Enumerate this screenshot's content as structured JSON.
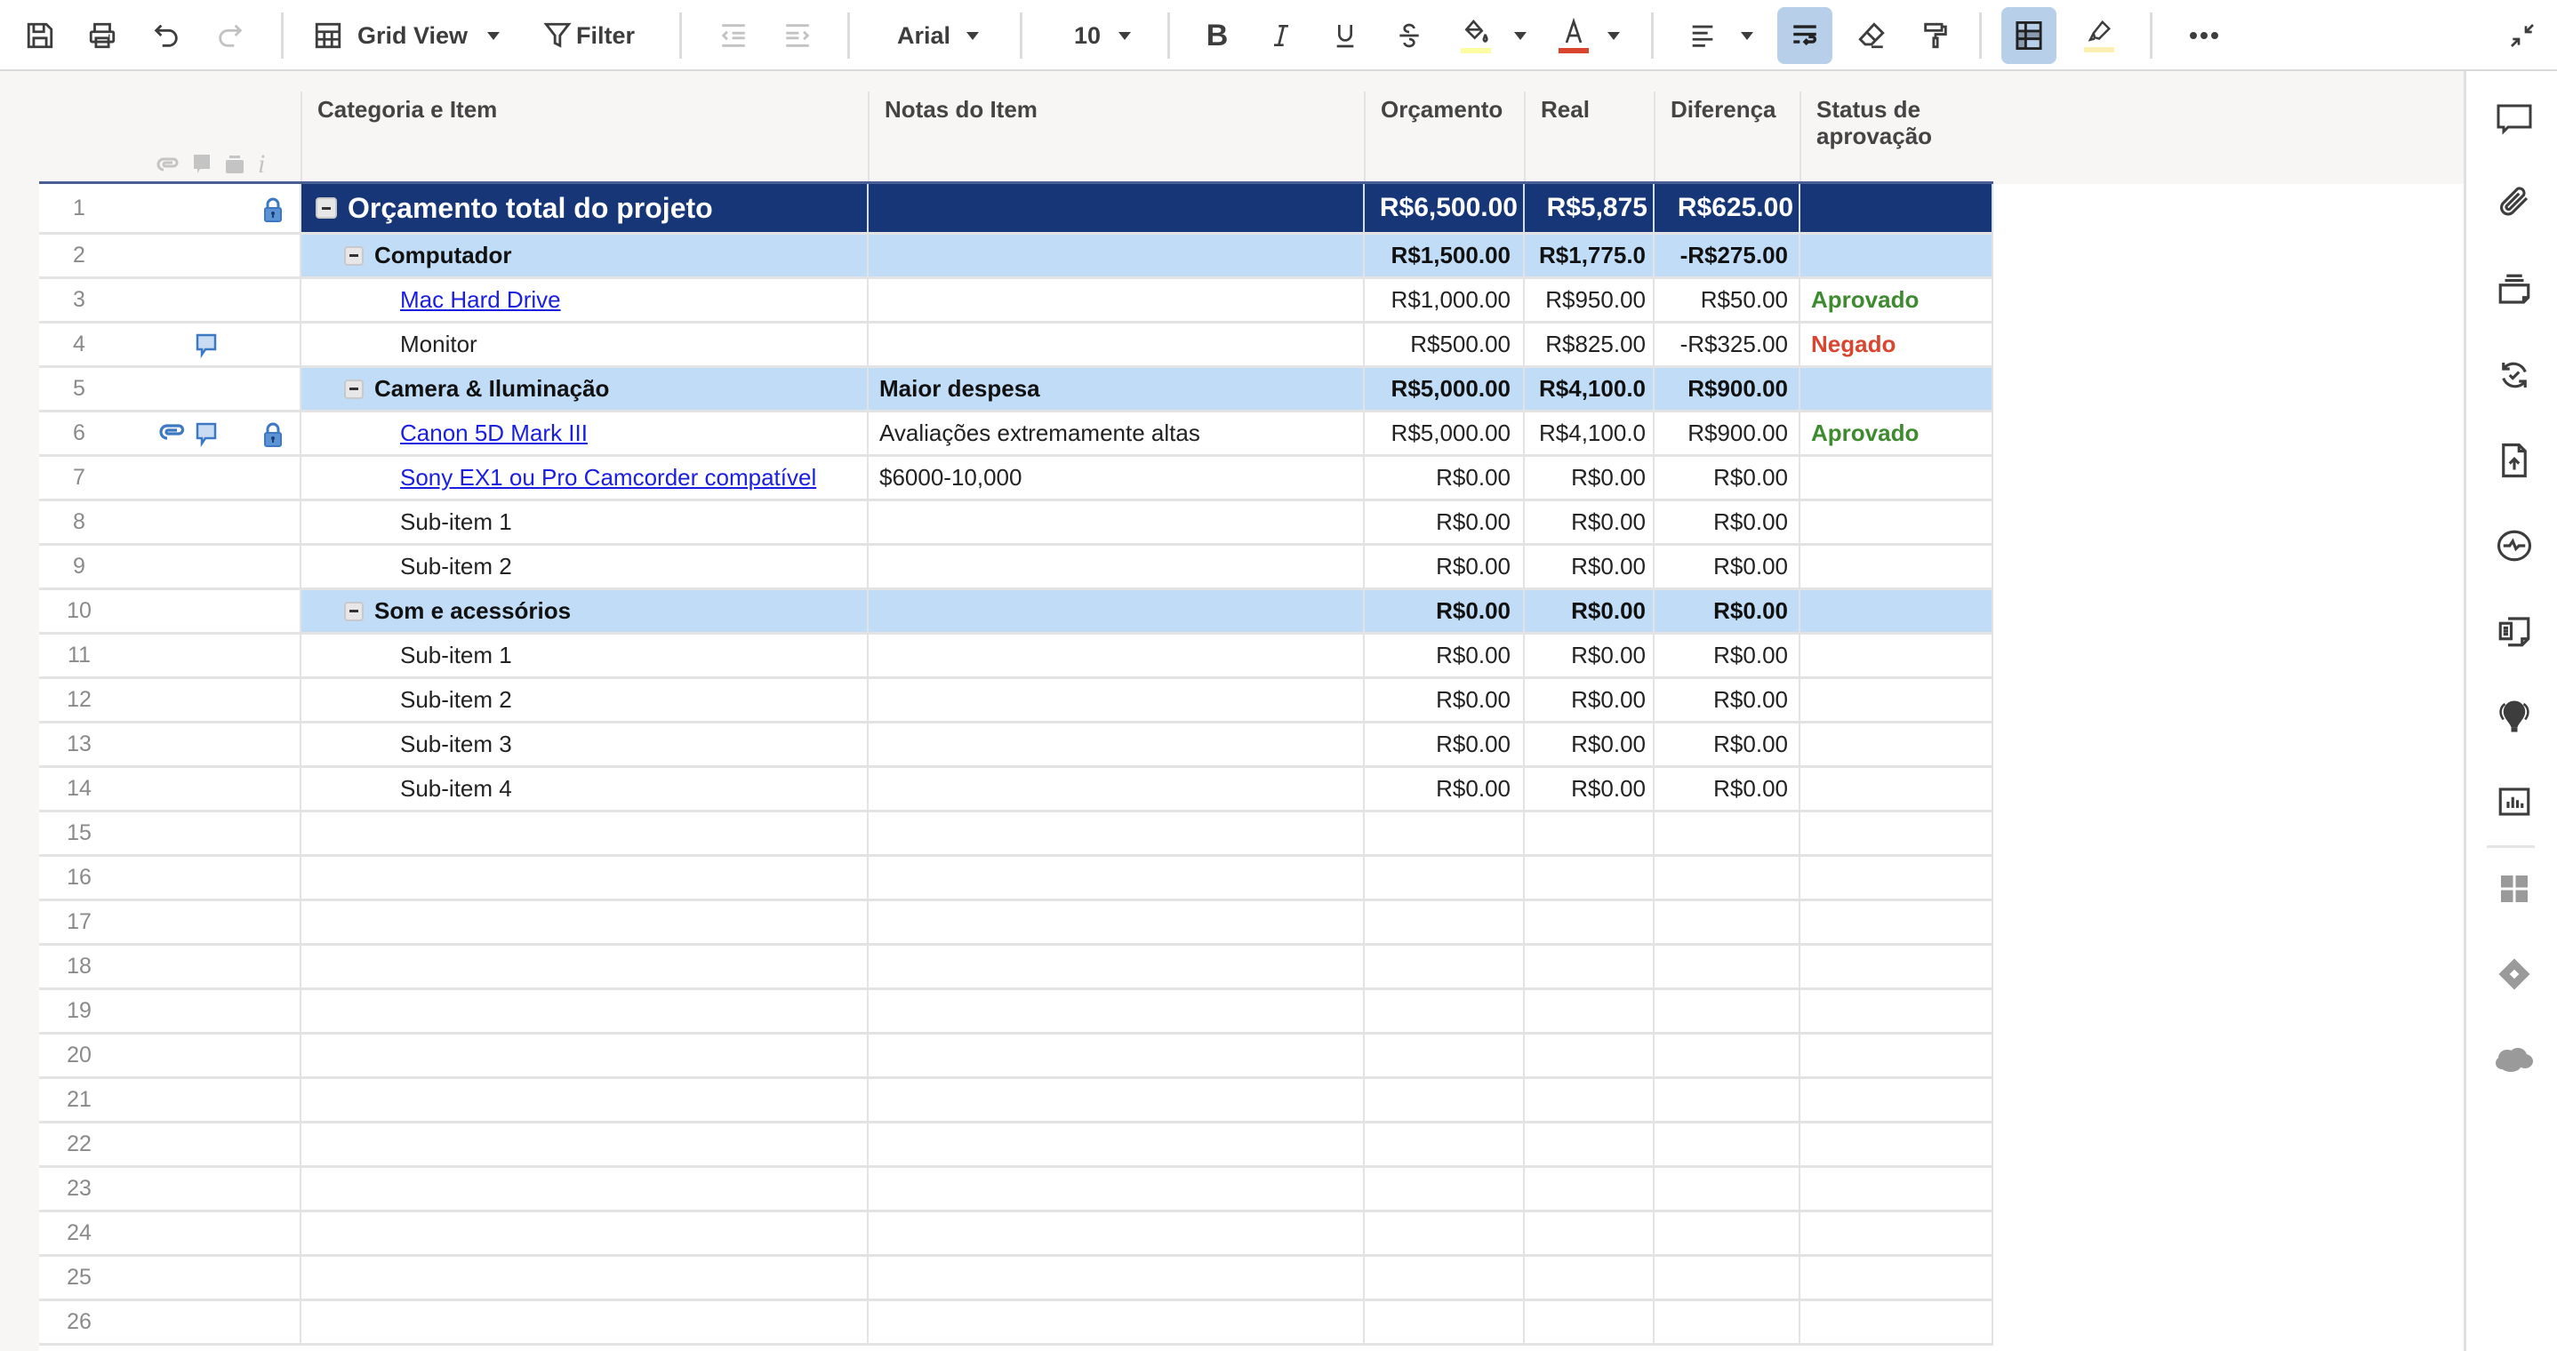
{
  "toolbar": {
    "view_label": "Grid View",
    "filter_label": "Filter",
    "font_name": "Arial",
    "font_size": "10",
    "fill_color": "#fdfca0",
    "text_color": "#d9452f",
    "highlight_color": "#fdf0b0",
    "wrap_text_active": true,
    "gridlines_active": true
  },
  "columns": {
    "category": "Categoria e Item",
    "notes": "Notas do Item",
    "budget": "Orçamento",
    "actual": "Real",
    "difference": "Diferença",
    "status": "Status de aprovação"
  },
  "colors": {
    "top_row_bg": "#163677",
    "group_row_bg": "#c0dcf6",
    "approved": "#3d8a2f",
    "denied": "#d9452f",
    "link": "#1a1ee0"
  },
  "rows": [
    {
      "n": "1",
      "level": 0,
      "category": "Orçamento total do projeto",
      "notes": "",
      "budget": "R$6,500.00",
      "actual": "R$5,875",
      "difference": "R$625.00",
      "status": "",
      "icons": [
        "lock"
      ]
    },
    {
      "n": "2",
      "level": 1,
      "category": "Computador",
      "notes": "",
      "budget": "R$1,500.00",
      "actual": "R$1,775.0",
      "difference": "-R$275.00",
      "status": "",
      "icons": []
    },
    {
      "n": "3",
      "level": 2,
      "category": "Mac Hard Drive",
      "link": true,
      "notes": "",
      "budget": "R$1,000.00",
      "actual": "R$950.00",
      "difference": "R$50.00",
      "status": "Aprovado",
      "icons": []
    },
    {
      "n": "4",
      "level": 2,
      "category": "Monitor",
      "notes": "",
      "budget": "R$500.00",
      "actual": "R$825.00",
      "difference": "-R$325.00",
      "status": "Negado",
      "icons": [
        "comment"
      ]
    },
    {
      "n": "5",
      "level": 1,
      "category": "Camera & Iluminação",
      "notes": "Maior despesa",
      "budget": "R$5,000.00",
      "actual": "R$4,100.0",
      "difference": "R$900.00",
      "status": "",
      "icons": []
    },
    {
      "n": "6",
      "level": 2,
      "category": "Canon 5D Mark III",
      "link": true,
      "notes": "Avaliações extremamente altas",
      "budget": "R$5,000.00",
      "actual": "R$4,100.0",
      "difference": "R$900.00",
      "status": "Aprovado",
      "icons": [
        "attachment",
        "comment",
        "lock"
      ]
    },
    {
      "n": "7",
      "level": 2,
      "category": "Sony EX1 ou Pro Camcorder compatível",
      "link": true,
      "notes": "$6000-10,000",
      "budget": "R$0.00",
      "actual": "R$0.00",
      "difference": "R$0.00",
      "status": "",
      "icons": []
    },
    {
      "n": "8",
      "level": 2,
      "category": "Sub-item 1",
      "notes": "",
      "budget": "R$0.00",
      "actual": "R$0.00",
      "difference": "R$0.00",
      "status": "",
      "icons": []
    },
    {
      "n": "9",
      "level": 2,
      "category": "Sub-item 2",
      "notes": "",
      "budget": "R$0.00",
      "actual": "R$0.00",
      "difference": "R$0.00",
      "status": "",
      "icons": []
    },
    {
      "n": "10",
      "level": 1,
      "category": "Som e acessórios",
      "notes": "",
      "budget": "R$0.00",
      "actual": "R$0.00",
      "difference": "R$0.00",
      "status": "",
      "icons": []
    },
    {
      "n": "11",
      "level": 2,
      "category": "Sub-item 1",
      "notes": "",
      "budget": "R$0.00",
      "actual": "R$0.00",
      "difference": "R$0.00",
      "status": "",
      "icons": []
    },
    {
      "n": "12",
      "level": 2,
      "category": "Sub-item 2",
      "notes": "",
      "budget": "R$0.00",
      "actual": "R$0.00",
      "difference": "R$0.00",
      "status": "",
      "icons": []
    },
    {
      "n": "13",
      "level": 2,
      "category": "Sub-item 3",
      "notes": "",
      "budget": "R$0.00",
      "actual": "R$0.00",
      "difference": "R$0.00",
      "status": "",
      "icons": []
    },
    {
      "n": "14",
      "level": 2,
      "category": "Sub-item 4",
      "notes": "",
      "budget": "R$0.00",
      "actual": "R$0.00",
      "difference": "R$0.00",
      "status": "",
      "icons": []
    },
    {
      "n": "15",
      "level": 3,
      "category": "",
      "notes": "",
      "budget": "",
      "actual": "",
      "difference": "",
      "status": "",
      "icons": []
    },
    {
      "n": "16",
      "level": 3,
      "category": "",
      "notes": "",
      "budget": "",
      "actual": "",
      "difference": "",
      "status": "",
      "icons": []
    },
    {
      "n": "17",
      "level": 3,
      "category": "",
      "notes": "",
      "budget": "",
      "actual": "",
      "difference": "",
      "status": "",
      "icons": []
    },
    {
      "n": "18",
      "level": 3,
      "category": "",
      "notes": "",
      "budget": "",
      "actual": "",
      "difference": "",
      "status": "",
      "icons": []
    },
    {
      "n": "19",
      "level": 3,
      "category": "",
      "notes": "",
      "budget": "",
      "actual": "",
      "difference": "",
      "status": "",
      "icons": []
    },
    {
      "n": "20",
      "level": 3,
      "category": "",
      "notes": "",
      "budget": "",
      "actual": "",
      "difference": "",
      "status": "",
      "icons": []
    },
    {
      "n": "21",
      "level": 3,
      "category": "",
      "notes": "",
      "budget": "",
      "actual": "",
      "difference": "",
      "status": "",
      "icons": []
    },
    {
      "n": "22",
      "level": 3,
      "category": "",
      "notes": "",
      "budget": "",
      "actual": "",
      "difference": "",
      "status": "",
      "icons": []
    },
    {
      "n": "23",
      "level": 3,
      "category": "",
      "notes": "",
      "budget": "",
      "actual": "",
      "difference": "",
      "status": "",
      "icons": []
    },
    {
      "n": "24",
      "level": 3,
      "category": "",
      "notes": "",
      "budget": "",
      "actual": "",
      "difference": "",
      "status": "",
      "icons": []
    },
    {
      "n": "25",
      "level": 3,
      "category": "",
      "notes": "",
      "budget": "",
      "actual": "",
      "difference": "",
      "status": "",
      "icons": []
    },
    {
      "n": "26",
      "level": 3,
      "category": "",
      "notes": "",
      "budget": "",
      "actual": "",
      "difference": "",
      "status": "",
      "icons": []
    }
  ],
  "sidebar": {
    "icons": [
      "comments-icon",
      "attachments-icon",
      "proofs-icon",
      "update-requests-icon",
      "publish-icon",
      "activity-log-icon",
      "summary-icon",
      "dynamic-view-icon",
      "chart-icon",
      "apps-icon",
      "integration-icon",
      "salesforce-icon"
    ]
  }
}
